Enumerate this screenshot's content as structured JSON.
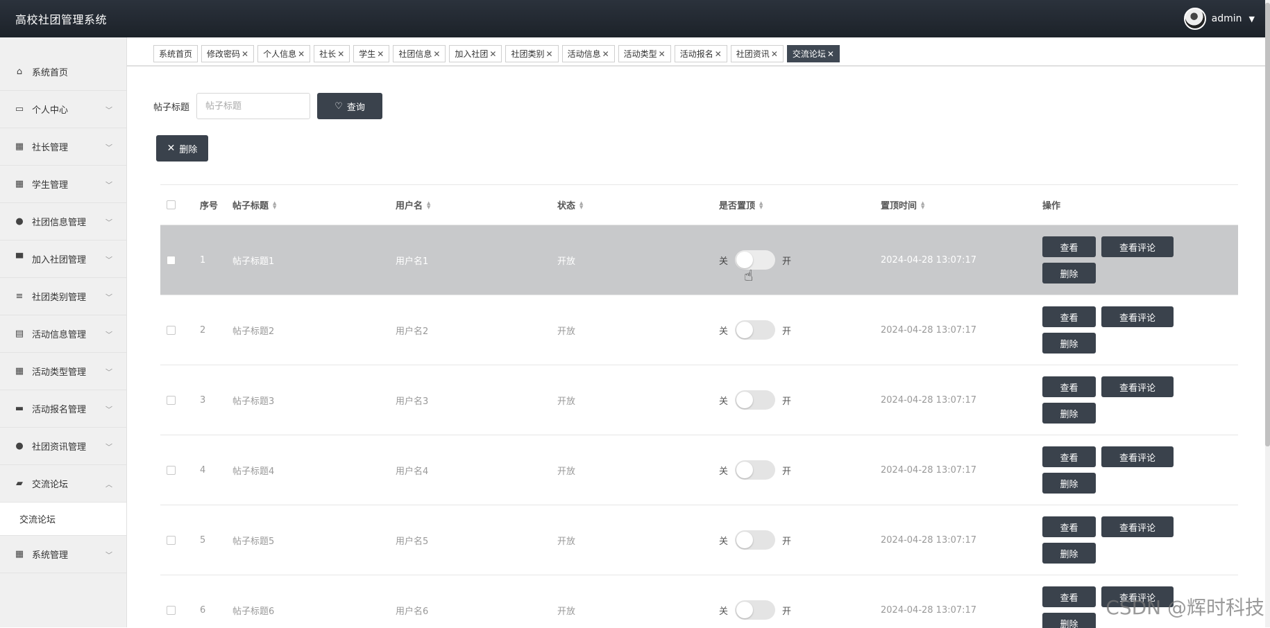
{
  "app": {
    "title": "高校社团管理系统",
    "user": "admin"
  },
  "sidebar": {
    "items": [
      {
        "label": "系统首页",
        "icon": "home-icon",
        "expandable": false
      },
      {
        "label": "个人中心",
        "icon": "window-icon",
        "expandable": true
      },
      {
        "label": "社长管理",
        "icon": "grid-icon",
        "expandable": true
      },
      {
        "label": "学生管理",
        "icon": "grid-icon",
        "expandable": true
      },
      {
        "label": "社团信息管理",
        "icon": "user-icon",
        "expandable": true
      },
      {
        "label": "加入社团管理",
        "icon": "stand-icon",
        "expandable": true
      },
      {
        "label": "社团类别管理",
        "icon": "list-icon",
        "expandable": true
      },
      {
        "label": "活动信息管理",
        "icon": "clipboard-icon",
        "expandable": true
      },
      {
        "label": "活动类型管理",
        "icon": "grid-icon",
        "expandable": true
      },
      {
        "label": "活动报名管理",
        "icon": "monitor-icon",
        "expandable": true
      },
      {
        "label": "社团资讯管理",
        "icon": "user-icon",
        "expandable": true
      },
      {
        "label": "交流论坛",
        "icon": "laptop-icon",
        "expandable": true,
        "open": true,
        "children": [
          "交流论坛"
        ]
      },
      {
        "label": "系统管理",
        "icon": "grid-icon",
        "expandable": true
      }
    ]
  },
  "tabs": [
    {
      "label": "系统首页",
      "closable": false
    },
    {
      "label": "修改密码",
      "closable": true
    },
    {
      "label": "个人信息",
      "closable": true
    },
    {
      "label": "社长",
      "closable": true
    },
    {
      "label": "学生",
      "closable": true
    },
    {
      "label": "社团信息",
      "closable": true
    },
    {
      "label": "加入社团",
      "closable": true
    },
    {
      "label": "社团类别",
      "closable": true
    },
    {
      "label": "活动信息",
      "closable": true
    },
    {
      "label": "活动类型",
      "closable": true
    },
    {
      "label": "活动报名",
      "closable": true
    },
    {
      "label": "社团资讯",
      "closable": true
    },
    {
      "label": "交流论坛",
      "closable": true,
      "active": true
    }
  ],
  "search": {
    "label": "帖子标题",
    "placeholder": "帖子标题",
    "button": "查询"
  },
  "toolbar": {
    "delete_label": "删除"
  },
  "table": {
    "headers": {
      "index": "序号",
      "title": "帖子标题",
      "user": "用户名",
      "status": "状态",
      "pinned": "是否置顶",
      "pin_time": "置顶时间",
      "ops": "操作"
    },
    "switch_off": "关",
    "switch_on": "开",
    "actions": {
      "view": "查看",
      "comments": "查看评论",
      "delete": "删除"
    },
    "rows": [
      {
        "index": "1",
        "title": "帖子标题1",
        "user": "用户名1",
        "status": "开放",
        "pin_time": "2024-04-28 13:07:17",
        "hover": true
      },
      {
        "index": "2",
        "title": "帖子标题2",
        "user": "用户名2",
        "status": "开放",
        "pin_time": "2024-04-28 13:07:17"
      },
      {
        "index": "3",
        "title": "帖子标题3",
        "user": "用户名3",
        "status": "开放",
        "pin_time": "2024-04-28 13:07:17"
      },
      {
        "index": "4",
        "title": "帖子标题4",
        "user": "用户名4",
        "status": "开放",
        "pin_time": "2024-04-28 13:07:17"
      },
      {
        "index": "5",
        "title": "帖子标题5",
        "user": "用户名5",
        "status": "开放",
        "pin_time": "2024-04-28 13:07:17"
      },
      {
        "index": "6",
        "title": "帖子标题6",
        "user": "用户名6",
        "status": "开放",
        "pin_time": "2024-04-28 13:07:17"
      }
    ]
  },
  "watermark": "CSDN @辉时科技"
}
